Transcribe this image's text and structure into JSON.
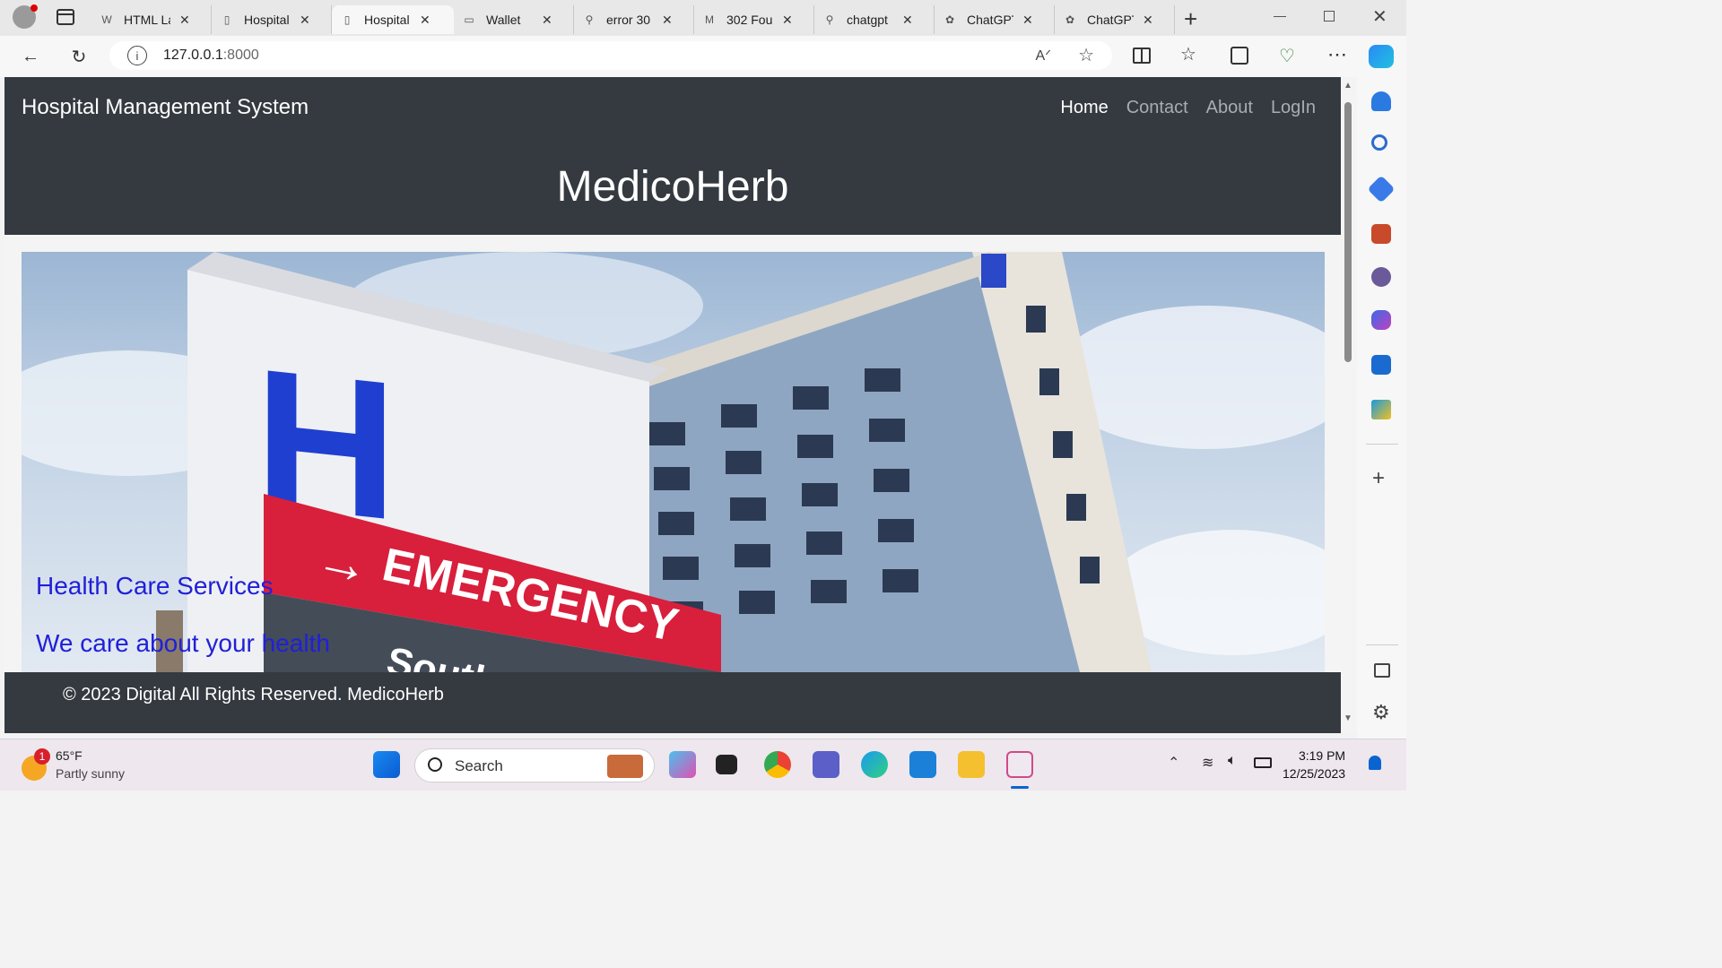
{
  "browser": {
    "tabs": [
      {
        "label": "HTML La",
        "icon": "w-site-icon"
      },
      {
        "label": "Hospital",
        "icon": "page-icon"
      },
      {
        "label": "Hospital",
        "icon": "page-icon",
        "active": true
      },
      {
        "label": "Wallet",
        "icon": "wallet-icon"
      },
      {
        "label": "error 30",
        "icon": "search-icon"
      },
      {
        "label": "302 Fou",
        "icon": "m-site-icon"
      },
      {
        "label": "chatgpt",
        "icon": "search-icon"
      },
      {
        "label": "ChatGPT",
        "icon": "openai-icon"
      },
      {
        "label": "ChatGPT",
        "icon": "openai-icon"
      }
    ],
    "url_host": "127.0.0.1",
    "url_port": ":8000"
  },
  "site": {
    "brand": "Hospital Management System",
    "nav": [
      "Home",
      "Contact",
      "About",
      "LogIn"
    ],
    "hero_title": "MedicoHerb",
    "caption_line1": "Health Care Services",
    "caption_line2": "We care about your health",
    "footer": "© 2023 Digital All Rights Reserved. MedicoHerb",
    "photo_sign_text": "EMERGENCY",
    "photo_sign_letter": "H",
    "photo_lower_sign_text": "South"
  },
  "taskbar": {
    "weather_temp": "65°F",
    "weather_desc": "Partly sunny",
    "weather_badge": "1",
    "search_label": "Search",
    "time": "3:19 PM",
    "date": "12/25/2023"
  },
  "colors": {
    "navbar": "#343a40",
    "caption": "#2020d8",
    "emergency_sign": "#d81f3c",
    "h_sign": "#1f3fd0"
  }
}
